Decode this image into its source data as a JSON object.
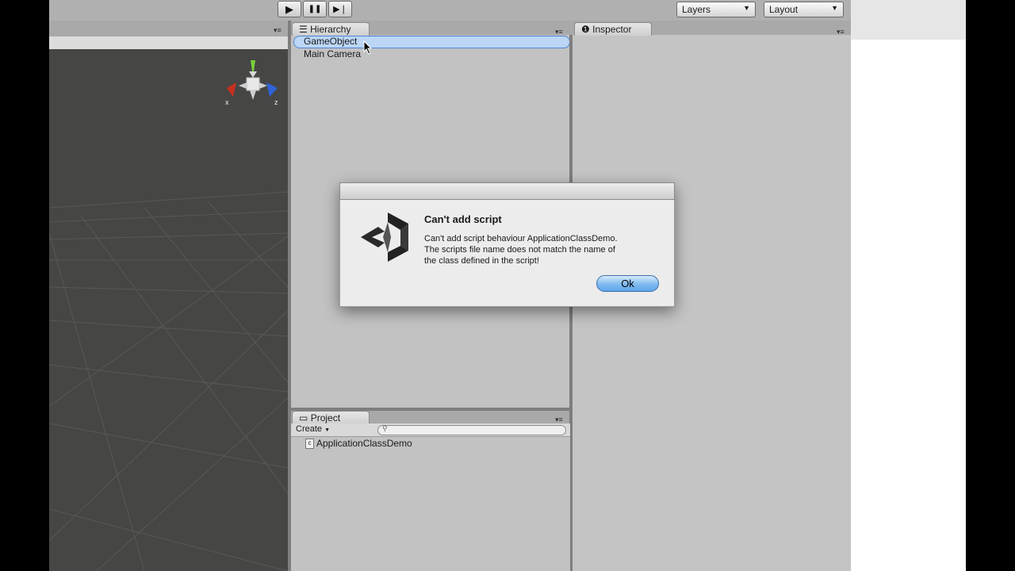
{
  "toolbar": {
    "play_label": "▶",
    "pause_label": "❚❚",
    "step_label": "▶❘",
    "layers_label": "Layers",
    "layout_label": "Layout"
  },
  "gizmo": {
    "x_label": "x",
    "z_label": "z"
  },
  "hierarchy": {
    "title": "Hierarchy",
    "items": [
      {
        "label": "GameObject",
        "selected": true
      },
      {
        "label": "Main Camera",
        "selected": false
      }
    ]
  },
  "inspector": {
    "title": "Inspector"
  },
  "project": {
    "title": "Project",
    "create_label": "Create",
    "search_placeholder": "",
    "items": [
      {
        "label": "ApplicationClassDemo",
        "icon": "script-file-icon"
      }
    ]
  },
  "dialog": {
    "title": "Can't add script",
    "message_lines": [
      "Can't add script behaviour ApplicationClassDemo.",
      "The scripts file name does not match the name of",
      "the class defined in the script!"
    ],
    "ok_label": "Ok"
  },
  "colors": {
    "selection": "#bcd6f5",
    "scene_bg": "#464645",
    "panel_bg": "#c2c2c2"
  }
}
